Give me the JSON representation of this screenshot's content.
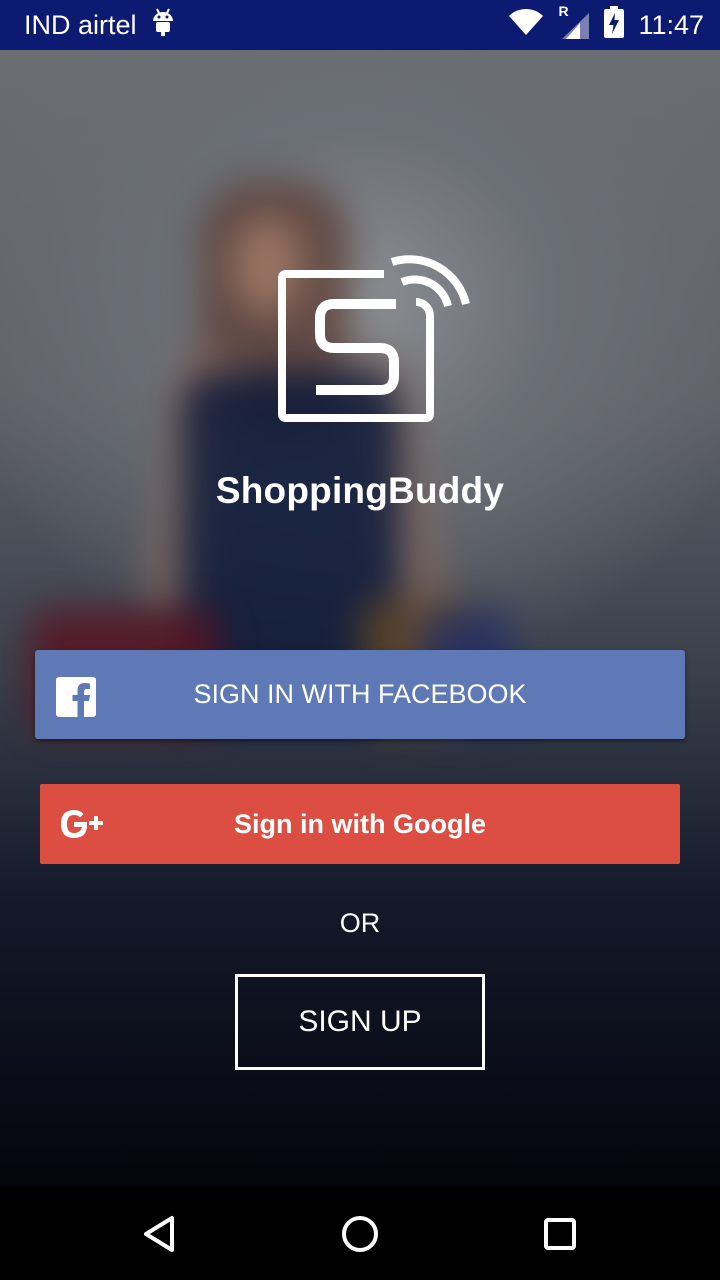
{
  "status_bar": {
    "carrier": "IND airtel",
    "time": "11:47",
    "icons": [
      "android-icon",
      "wifi-icon",
      "signal-icon",
      "battery-charging-icon"
    ],
    "roaming_indicator": "R"
  },
  "app": {
    "name": "ShoppingBuddy",
    "logo_letter": "S"
  },
  "buttons": {
    "facebook_label": "SIGN IN WITH FACEBOOK",
    "google_label": "Sign in with Google",
    "or_label": "OR",
    "signup_label": "SIGN UP"
  },
  "nav_bar": {
    "icons": [
      "back-icon",
      "home-icon",
      "recents-icon"
    ]
  },
  "colors": {
    "status_bar": "#0d1a72",
    "facebook": "#5e79b6",
    "google": "#dc4e41"
  }
}
